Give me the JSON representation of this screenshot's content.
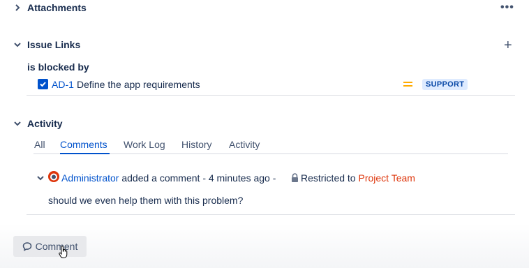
{
  "attachments": {
    "title": "Attachments",
    "more_label": "•••"
  },
  "issue_links": {
    "title": "Issue Links",
    "add_label": "+",
    "relation": "is blocked by",
    "items": [
      {
        "key": "AD-1",
        "summary": "Define the app requirements",
        "priority_icon": "priority-medium-icon",
        "status": "SUPPORT"
      }
    ]
  },
  "activity": {
    "title": "Activity",
    "tabs": [
      {
        "label": "All",
        "active": false
      },
      {
        "label": "Comments",
        "active": true
      },
      {
        "label": "Work Log",
        "active": false
      },
      {
        "label": "History",
        "active": false
      },
      {
        "label": "Activity",
        "active": false
      }
    ],
    "comment": {
      "author": "Administrator",
      "action": "added a comment - 4 minutes ago -",
      "restricted_label": "Restricted to",
      "restricted_group": "Project Team",
      "body": "should we even help them with this problem?"
    }
  },
  "footer": {
    "comment_button": "Comment"
  },
  "colors": {
    "link": "#0052cc",
    "text": "#172b4d",
    "restricted": "#de350b",
    "badge_bg": "#deebff",
    "priority": "#ffab00"
  }
}
